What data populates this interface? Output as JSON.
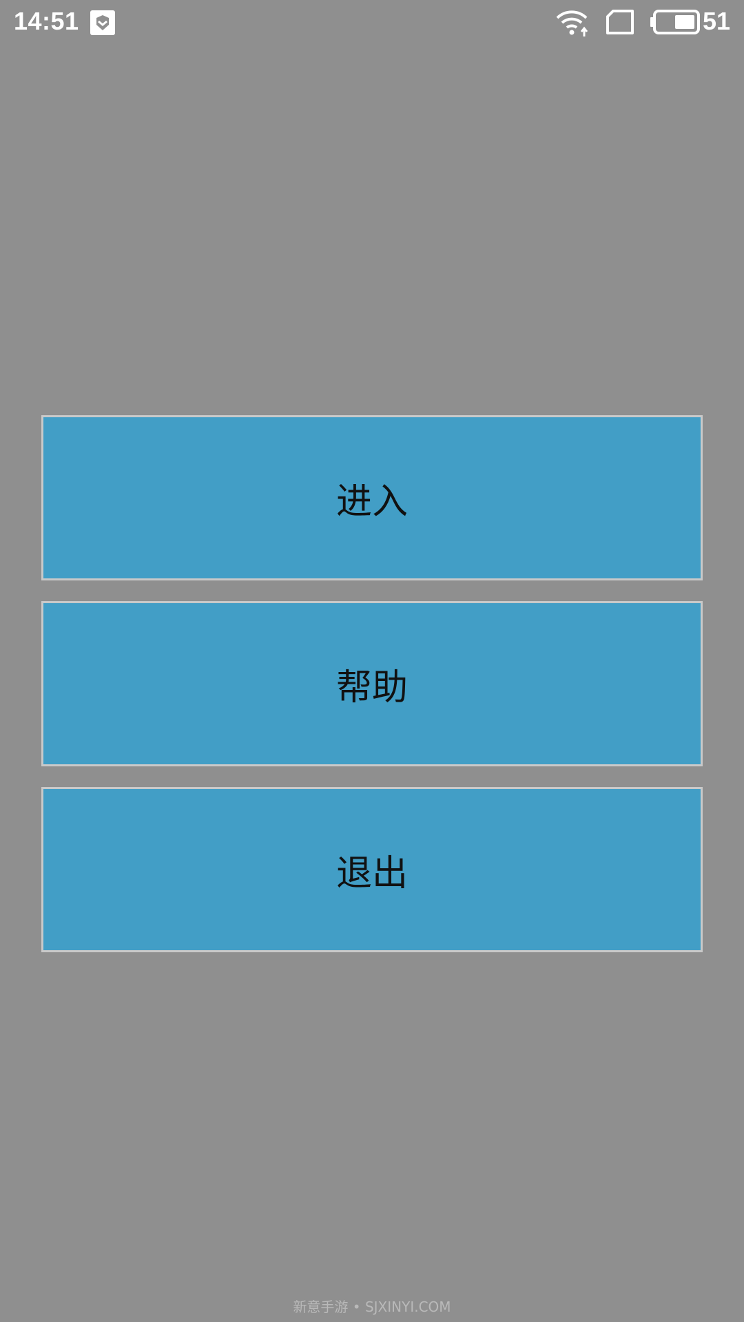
{
  "status_bar": {
    "time": "14:51",
    "battery_level": "51",
    "icons": [
      "notification-shield-icon",
      "wifi-icon",
      "sim-card-icon",
      "battery-icon"
    ]
  },
  "menu": {
    "items": [
      {
        "label": "进入"
      },
      {
        "label": "帮助"
      },
      {
        "label": "退出"
      }
    ]
  },
  "watermark": "新意手游 • SJXINYI.COM",
  "colors": {
    "background": "#8f8f8f",
    "button_fill": "#429ec6",
    "button_border": "#c9c9c9"
  }
}
